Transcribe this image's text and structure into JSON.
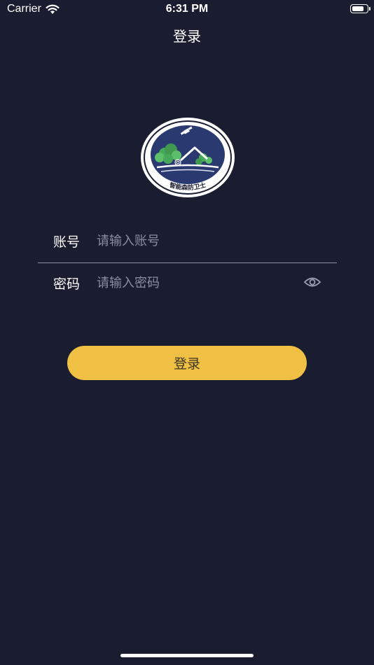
{
  "status_bar": {
    "carrier": "Carrier",
    "time": "6:31 PM",
    "wifi_icon": "wifi-icon",
    "battery_icon": "battery-icon"
  },
  "nav": {
    "title": "登录"
  },
  "logo": {
    "text": "智能森防卫士",
    "colors": {
      "ring": "#ffffff",
      "inner": "#2a3970",
      "trees": "#48a95a"
    }
  },
  "form": {
    "account": {
      "label": "账号",
      "placeholder": "请输入账号",
      "value": ""
    },
    "password": {
      "label": "密码",
      "placeholder": "请输入密码",
      "value": "",
      "toggle_icon": "eye-icon"
    }
  },
  "login_button": {
    "label": "登录",
    "color": "#f0c045"
  },
  "theme": {
    "background": "#1a1c30",
    "divider": "#8e92a8"
  }
}
